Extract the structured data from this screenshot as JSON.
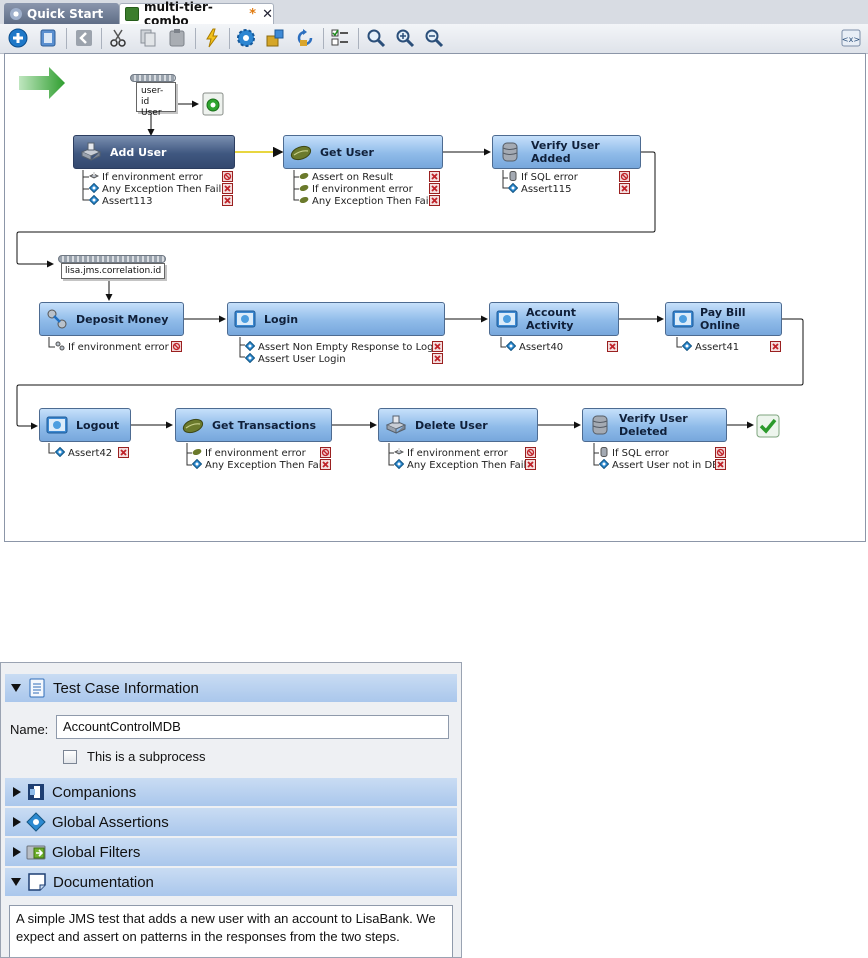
{
  "tabs": [
    {
      "label": "Quick Start",
      "active": false
    },
    {
      "label": "multi-tier-combo",
      "active": true,
      "modified_marker": "*",
      "close": "✕"
    }
  ],
  "colors": {
    "node_fill": "#8fbbe9",
    "node_selected_fill": "#3f5780",
    "section_header": "#aac7ec",
    "start_arrow": "#3aae3a",
    "fail_red": "#c0232a"
  },
  "toolbar": {
    "icons": [
      "add-step-icon",
      "delete-step-icon",
      "back-icon",
      "cut-icon",
      "copy-icon",
      "paste-icon",
      "lightning-icon",
      "settings-gear-icon",
      "component-icon",
      "refresh-icon",
      "checklist-icon",
      "search-icon",
      "zoom-in-icon",
      "zoom-out-icon",
      "xml-view-icon"
    ]
  },
  "workflow": {
    "datasets": [
      {
        "line1": "user-id",
        "line2": "User"
      },
      {
        "line1": "lisa.jms.correlation.id",
        "line2": ""
      }
    ],
    "steps": [
      {
        "name": "Add User",
        "icon": "web-service-icon",
        "selected": true,
        "assertions": [
          "If environment error",
          "Any Exception Then Fail",
          "Assert113"
        ]
      },
      {
        "name": "Get User",
        "icon": "java-bean-icon",
        "selected": false,
        "assertions": [
          "Assert on Result",
          "If environment error",
          "Any Exception Then Fail"
        ]
      },
      {
        "name": "Verify User Added",
        "icon": "database-icon",
        "selected": false,
        "assertions": [
          "If SQL error",
          "Assert115"
        ]
      },
      {
        "name": "Deposit Money",
        "icon": "jms-icon",
        "selected": false,
        "assertions": [
          "If environment error"
        ]
      },
      {
        "name": "Login",
        "icon": "web-page-icon",
        "selected": false,
        "assertions": [
          "Assert Non Empty Response to Login",
          "Assert User Login"
        ]
      },
      {
        "name": "Account Activity",
        "icon": "web-page-icon",
        "selected": false,
        "assertions": [
          "Assert40"
        ]
      },
      {
        "name": "Pay Bill Online",
        "icon": "web-page-icon",
        "selected": false,
        "assertions": [
          "Assert41"
        ]
      },
      {
        "name": "Logout",
        "icon": "web-page-icon",
        "selected": false,
        "assertions": [
          "Assert42"
        ]
      },
      {
        "name": "Get Transactions",
        "icon": "java-bean-icon",
        "selected": false,
        "assertions": [
          "If environment error",
          "Any Exception Then Fail"
        ]
      },
      {
        "name": "Delete User",
        "icon": "web-service-icon",
        "selected": false,
        "assertions": [
          "If environment error",
          "Any Exception Then Fail"
        ]
      },
      {
        "name": "Verify User Deleted",
        "icon": "database-icon",
        "selected": false,
        "assertions": [
          "If SQL error",
          "Assert User not in DB"
        ]
      }
    ]
  },
  "properties": {
    "sections": [
      {
        "label": "Test Case Information",
        "expanded": true
      },
      {
        "label": "Companions",
        "expanded": false
      },
      {
        "label": "Global Assertions",
        "expanded": false
      },
      {
        "label": "Global Filters",
        "expanded": false
      },
      {
        "label": "Documentation",
        "expanded": true
      }
    ],
    "name_label": "Name:",
    "name_value": "AccountControlMDB",
    "subprocess_label": "This is a subprocess",
    "subprocess_checked": false,
    "documentation": "A simple JMS test that adds a new user with an account to LisaBank. We expect and assert on patterns in the responses from the two steps."
  }
}
